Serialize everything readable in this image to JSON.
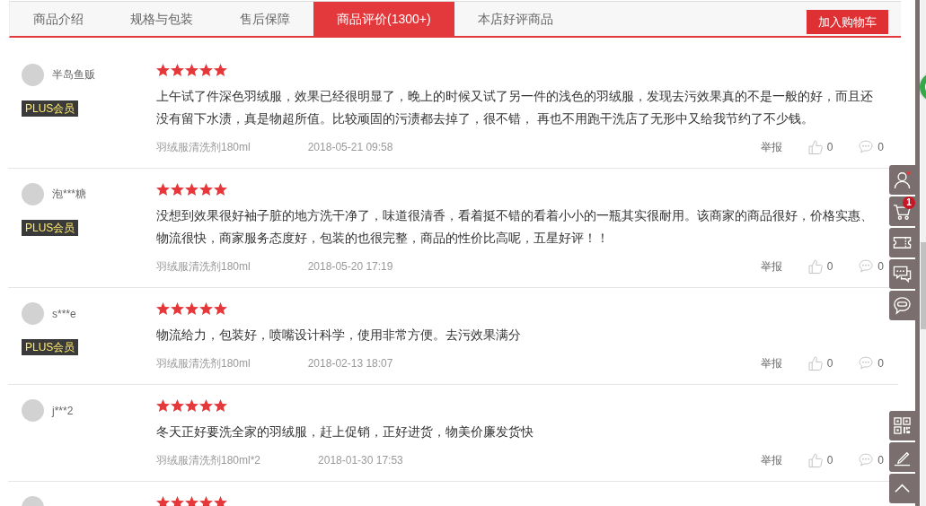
{
  "tabs": [
    {
      "label": "商品介绍",
      "selected": false
    },
    {
      "label": "规格与包装",
      "selected": false
    },
    {
      "label": "售后保障",
      "selected": false
    },
    {
      "label": "商品评价(1300+)",
      "selected": true
    },
    {
      "label": "本店好评商品",
      "selected": false
    }
  ],
  "cart_button": {
    "label": "加入购物车"
  },
  "reviews": [
    {
      "user": "半岛鱼贩",
      "badge": "PLUS会员",
      "stars": 5,
      "text": "上午试了件深色羽绒服，效果已经很明显了，晚上的时候又试了另一件的浅色的羽绒服，发现去污效果真的不是一般的好，而且还没有留下水渍，真是物超所值。比较顽固的污渍都去掉了，很不错， 再也不用跑干洗店了无形中又给我节约了不少钱。",
      "product": "羽绒服清洗剂180ml",
      "date": "2018-05-21 09:58",
      "report": "举报",
      "likes": "0",
      "replies": "0"
    },
    {
      "user": "泡***糖",
      "badge": "PLUS会员",
      "stars": 5,
      "text": "没想到效果很好袖子脏的地方洗干净了，味道很清香，看着挺不错的看着小小的一瓶其实很耐用。该商家的商品很好，价格实惠、物流很快，商家服务态度好，包装的也很完整，商品的性价比高呢，五星好评！！",
      "product": "羽绒服清洗剂180ml",
      "date": "2018-05-20 17:19",
      "report": "举报",
      "likes": "0",
      "replies": "0"
    },
    {
      "user": "s***e",
      "badge": "PLUS会员",
      "stars": 5,
      "text": "物流给力，包装好，喷嘴设计科学，使用非常方便。去污效果满分",
      "product": "羽绒服清洗剂180ml",
      "date": "2018-02-13 18:07",
      "report": "举报",
      "likes": "0",
      "replies": "0"
    },
    {
      "user": "j***2",
      "stars": 5,
      "text": "冬天正好要洗全家的羽绒服，赶上促销，正好进货，物美价廉发货快",
      "product": "羽绒服清洗剂180ml*2",
      "date": "2018-01-30 17:53",
      "report": "举报",
      "likes": "0",
      "replies": "0"
    },
    {
      "stars": 5
    }
  ],
  "sidebar": {
    "top": [
      {
        "kind": "user"
      },
      {
        "kind": "cart",
        "badge": "1"
      },
      {
        "kind": "coupon"
      },
      {
        "kind": "message"
      },
      {
        "kind": "service"
      }
    ],
    "bottom": [
      {
        "kind": "qrcode"
      },
      {
        "kind": "feedback"
      },
      {
        "kind": "top"
      }
    ]
  }
}
